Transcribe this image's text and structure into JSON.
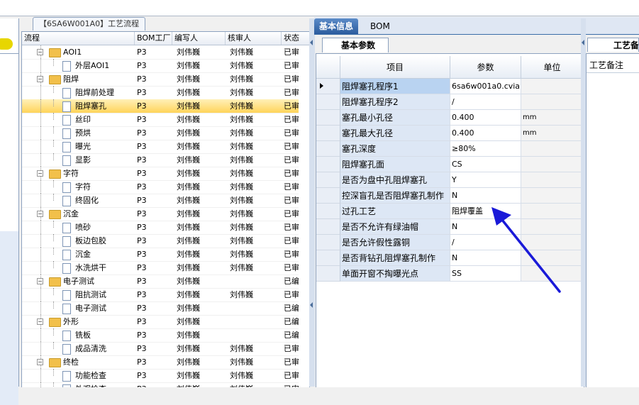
{
  "tree_tab": "【6SA6W001A0】工艺流程",
  "tree_columns": [
    "流程",
    "BOM工厂",
    "编写人",
    "核审人",
    "状态"
  ],
  "tree_rows": [
    {
      "level": 1,
      "type": "folder",
      "name": "AOI1",
      "plant": "P3",
      "writer": "刘伟巍",
      "reviewer": "刘伟巍",
      "status": "已审"
    },
    {
      "level": 2,
      "type": "doc",
      "name": "外层AOI1",
      "plant": "P3",
      "writer": "刘伟巍",
      "reviewer": "刘伟巍",
      "status": "已审"
    },
    {
      "level": 1,
      "type": "folder",
      "name": "阻焊",
      "plant": "P3",
      "writer": "刘伟巍",
      "reviewer": "刘伟巍",
      "status": "已审"
    },
    {
      "level": 2,
      "type": "doc",
      "name": "阻焊前处理",
      "plant": "P3",
      "writer": "刘伟巍",
      "reviewer": "刘伟巍",
      "status": "已审"
    },
    {
      "level": 2,
      "type": "doc",
      "name": "阻焊塞孔",
      "plant": "P3",
      "writer": "刘伟巍",
      "reviewer": "刘伟巍",
      "status": "已审",
      "selected": true
    },
    {
      "level": 2,
      "type": "doc",
      "name": "丝印",
      "plant": "P3",
      "writer": "刘伟巍",
      "reviewer": "刘伟巍",
      "status": "已审"
    },
    {
      "level": 2,
      "type": "doc",
      "name": "预烘",
      "plant": "P3",
      "writer": "刘伟巍",
      "reviewer": "刘伟巍",
      "status": "已审"
    },
    {
      "level": 2,
      "type": "doc",
      "name": "曝光",
      "plant": "P3",
      "writer": "刘伟巍",
      "reviewer": "刘伟巍",
      "status": "已审"
    },
    {
      "level": 2,
      "type": "doc",
      "name": "显影",
      "plant": "P3",
      "writer": "刘伟巍",
      "reviewer": "刘伟巍",
      "status": "已审"
    },
    {
      "level": 1,
      "type": "folder",
      "name": "字符",
      "plant": "P3",
      "writer": "刘伟巍",
      "reviewer": "刘伟巍",
      "status": "已审"
    },
    {
      "level": 2,
      "type": "doc",
      "name": "字符",
      "plant": "P3",
      "writer": "刘伟巍",
      "reviewer": "刘伟巍",
      "status": "已审"
    },
    {
      "level": 2,
      "type": "doc",
      "name": "终固化",
      "plant": "P3",
      "writer": "刘伟巍",
      "reviewer": "刘伟巍",
      "status": "已审"
    },
    {
      "level": 1,
      "type": "folder",
      "name": "沉金",
      "plant": "P3",
      "writer": "刘伟巍",
      "reviewer": "刘伟巍",
      "status": "已审"
    },
    {
      "level": 2,
      "type": "doc",
      "name": "喷砂",
      "plant": "P3",
      "writer": "刘伟巍",
      "reviewer": "刘伟巍",
      "status": "已审"
    },
    {
      "level": 2,
      "type": "doc",
      "name": "板边包胶",
      "plant": "P3",
      "writer": "刘伟巍",
      "reviewer": "刘伟巍",
      "status": "已审"
    },
    {
      "level": 2,
      "type": "doc",
      "name": "沉金",
      "plant": "P3",
      "writer": "刘伟巍",
      "reviewer": "刘伟巍",
      "status": "已审"
    },
    {
      "level": 2,
      "type": "doc",
      "name": "水洗烘干",
      "plant": "P3",
      "writer": "刘伟巍",
      "reviewer": "刘伟巍",
      "status": "已审"
    },
    {
      "level": 1,
      "type": "folder",
      "name": "电子测试",
      "plant": "P3",
      "writer": "刘伟巍",
      "reviewer": "",
      "status": "已编"
    },
    {
      "level": 2,
      "type": "doc",
      "name": "阻抗测试",
      "plant": "P3",
      "writer": "刘伟巍",
      "reviewer": "刘伟巍",
      "status": "已审"
    },
    {
      "level": 2,
      "type": "doc",
      "name": "电子测试",
      "plant": "P3",
      "writer": "刘伟巍",
      "reviewer": "",
      "status": "已编"
    },
    {
      "level": 1,
      "type": "folder",
      "name": "外形",
      "plant": "P3",
      "writer": "刘伟巍",
      "reviewer": "",
      "status": "已编"
    },
    {
      "level": 2,
      "type": "doc",
      "name": "铣板",
      "plant": "P3",
      "writer": "刘伟巍",
      "reviewer": "",
      "status": "已编"
    },
    {
      "level": 2,
      "type": "doc",
      "name": "成品清洗",
      "plant": "P3",
      "writer": "刘伟巍",
      "reviewer": "刘伟巍",
      "status": "已审"
    },
    {
      "level": 1,
      "type": "folder",
      "name": "终检",
      "plant": "P3",
      "writer": "刘伟巍",
      "reviewer": "刘伟巍",
      "status": "已审"
    },
    {
      "level": 2,
      "type": "doc",
      "name": "功能检查",
      "plant": "P3",
      "writer": "刘伟巍",
      "reviewer": "刘伟巍",
      "status": "已审"
    },
    {
      "level": 2,
      "type": "doc",
      "name": "外观检查",
      "plant": "P3",
      "writer": "刘伟巍",
      "reviewer": "刘伟巍",
      "status": "已审"
    }
  ],
  "tabs": {
    "basic_info": "基本信息",
    "bom": "BOM"
  },
  "subtab_label": "基本参数",
  "grid_headers": {
    "item": "项目",
    "param": "参数",
    "unit": "单位"
  },
  "params": [
    {
      "item": "阻焊塞孔程序1",
      "value": "6sa6w001a0.cvia",
      "unit": ""
    },
    {
      "item": "阻焊塞孔程序2",
      "value": "/",
      "unit": ""
    },
    {
      "item": "塞孔最小孔径",
      "value": "0.400",
      "unit": "mm"
    },
    {
      "item": "塞孔最大孔径",
      "value": "0.400",
      "unit": "mm"
    },
    {
      "item": "塞孔深度",
      "value": "≥80%",
      "unit": ""
    },
    {
      "item": "阻焊塞孔面",
      "value": "CS",
      "unit": ""
    },
    {
      "item": "是否为盘中孔阻焊塞孔",
      "value": "Y",
      "unit": ""
    },
    {
      "item": "控深盲孔是否阻焊塞孔制作",
      "value": "N",
      "unit": ""
    },
    {
      "item": "过孔工艺",
      "value": "阻焊覆盖",
      "unit": ""
    },
    {
      "item": "是否不允许有绿油帽",
      "value": "N",
      "unit": ""
    },
    {
      "item": "是否允许假性露铜",
      "value": "/",
      "unit": ""
    },
    {
      "item": "是否背钻孔阻焊塞孔制作",
      "value": "N",
      "unit": ""
    },
    {
      "item": "单面开窗不掏曝光点",
      "value": "SS",
      "unit": ""
    }
  ],
  "remark_tab": "工艺备注",
  "remark_label": "工艺备注",
  "annotation_arrow_color": "#1a1ad8",
  "selection_color": "#ffd45a"
}
